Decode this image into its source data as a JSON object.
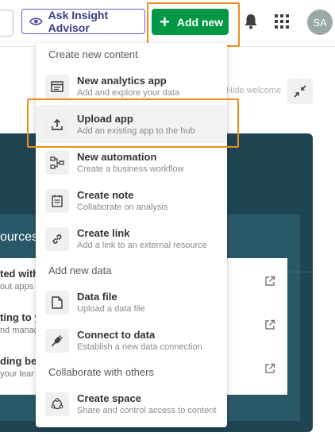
{
  "header": {
    "insight_label": "Ask Insight Advisor",
    "add_new_label": "Add new",
    "avatar_initials": "SA"
  },
  "background": {
    "hide_welcome": "Hide welcome",
    "resources_title": "ources",
    "resources": [
      {
        "title": "ted with",
        "sub": "out apps a"
      },
      {
        "title": "ting to y",
        "sub": "nd manag"
      },
      {
        "title": "ding bey",
        "sub": "your lear"
      }
    ]
  },
  "menu": {
    "sections": {
      "create": "Create new content",
      "data": "Add new data",
      "collab": "Collaborate with others"
    },
    "items": [
      {
        "title": "New analytics app",
        "sub": "Add and explore your data",
        "icon": "app-icon"
      },
      {
        "title": "Upload app",
        "sub": "Add an existing app to the hub",
        "icon": "upload-icon"
      },
      {
        "title": "New automation",
        "sub": "Create a business workflow",
        "icon": "automation-icon"
      },
      {
        "title": "Create note",
        "sub": "Collaborate on analysis",
        "icon": "note-icon"
      },
      {
        "title": "Create link",
        "sub": "Add a link to an external resource",
        "icon": "link-icon"
      },
      {
        "title": "Data file",
        "sub": "Upload a data file",
        "icon": "file-icon"
      },
      {
        "title": "Connect to data",
        "sub": "Establish a new data connection",
        "icon": "plug-icon"
      },
      {
        "title": "Create space",
        "sub": "Share and control access to content",
        "icon": "space-icon"
      }
    ]
  },
  "colors": {
    "brand_green": "#009845",
    "highlight_orange": "#ef8a1e",
    "hero_dark": "#1f4553",
    "insight_purple": "#6a5acd"
  }
}
